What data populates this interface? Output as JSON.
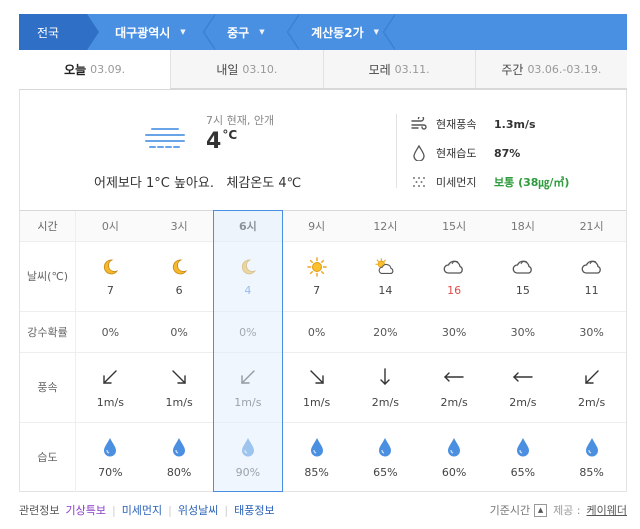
{
  "breadcrumb": {
    "items": [
      {
        "label": "전국"
      },
      {
        "label": "대구광역시"
      },
      {
        "label": "중구"
      },
      {
        "label": "계산동2가"
      }
    ]
  },
  "tabs": [
    {
      "label": "오늘",
      "date": "03.09."
    },
    {
      "label": "내일",
      "date": "03.10."
    },
    {
      "label": "모레",
      "date": "03.11."
    },
    {
      "label": "주간",
      "date": "03.06.-03.19."
    }
  ],
  "current": {
    "time_status": "7시 현재, 안개",
    "temp": "4",
    "temp_unit": "°C",
    "compare_text": "어제보다 1°C 높아요.",
    "feels_text": "체감온도 4℃",
    "wind_label": "현재풍속",
    "wind_value": "1.3m/s",
    "humidity_label": "현재습도",
    "humidity_value": "87%",
    "dust_label": "미세먼지",
    "dust_value": "보통 (38㎍/㎥)"
  },
  "table": {
    "headers": {
      "time": "시간",
      "weather_line1": "날씨",
      "weather_line2": "(℃)",
      "rain": "강수확률",
      "wind": "풍속",
      "humidity": "습도"
    },
    "times": [
      "0시",
      "3시",
      "6시",
      "9시",
      "12시",
      "15시",
      "18시",
      "21시"
    ],
    "weather_icons": [
      "moon-icon",
      "moon-icon",
      "moon-icon",
      "sun-icon",
      "sun-cloud-icon",
      "cloud-icon",
      "cloud-icon",
      "cloud-icon"
    ],
    "temps": [
      "7",
      "6",
      "4",
      "7",
      "14",
      "16",
      "15",
      "11"
    ],
    "rain_prob": [
      "0%",
      "0%",
      "0%",
      "0%",
      "20%",
      "30%",
      "30%",
      "30%"
    ],
    "wind_dirs": [
      "arrow-down-left-icon",
      "arrow-down-right-icon",
      "arrow-down-left-icon",
      "arrow-down-right-icon",
      "arrow-down-icon",
      "arrow-left-icon",
      "arrow-left-icon",
      "arrow-down-left-icon"
    ],
    "wind_speeds": [
      "1m/s",
      "1m/s",
      "1m/s",
      "1m/s",
      "2m/s",
      "2m/s",
      "2m/s",
      "2m/s"
    ],
    "humidity": [
      "70%",
      "80%",
      "90%",
      "85%",
      "65%",
      "60%",
      "65%",
      "85%"
    ],
    "selected_index": 2
  },
  "footer": {
    "related_label": "관련정보",
    "links": [
      "기상특보",
      "미세먼지",
      "위성날씨",
      "태풍정보"
    ],
    "base_time_label": "기준시간",
    "provider_prefix": "제공 :",
    "provider": "케이웨더"
  },
  "colors": {
    "accent": "#4a90e2",
    "accent_dark": "#2f6fc6",
    "highlight_temp": "#3b7de0",
    "hot_temp": "#e24a4a",
    "good_status": "#2e9b3c",
    "link_purple": "#8a3cc7"
  }
}
